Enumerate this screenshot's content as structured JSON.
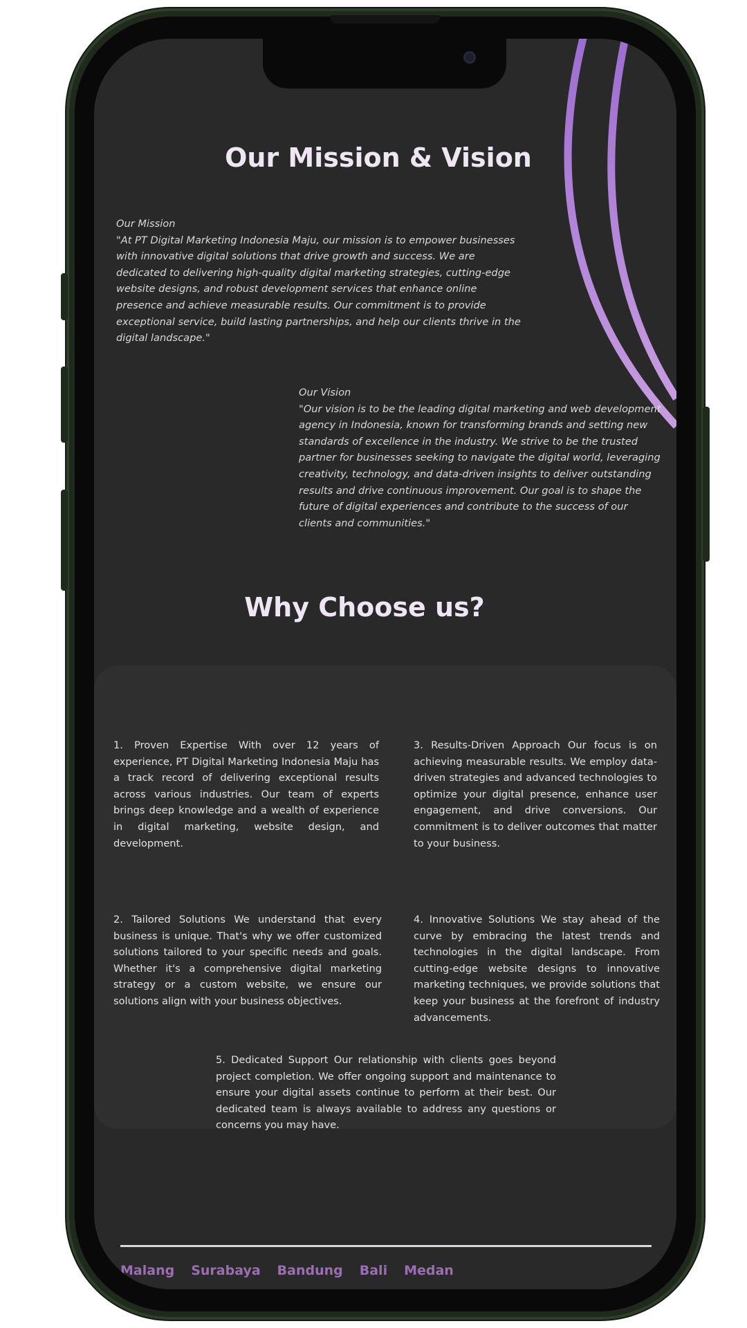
{
  "mission_vision": {
    "title": "Our Mission & Vision",
    "mission_label": "Our Mission",
    "mission_text": "\"At PT Digital Marketing Indonesia Maju, our mission is to empower businesses with innovative digital solutions that drive growth and success. We are dedicated to delivering high-quality digital marketing strategies, cutting-edge website designs, and robust development services that enhance online presence and achieve measurable results. Our commitment is to provide exceptional service, build lasting partnerships, and help our clients thrive in the digital landscape.\"",
    "vision_label": "Our Vision",
    "vision_text": "\"Our vision is to be the leading digital marketing and web development agency in Indonesia, known for transforming brands and setting new standards of excellence in the industry. We strive to be the trusted partner for businesses seeking to navigate the digital world, leveraging creativity, technology, and data-driven insights to deliver outstanding results and drive continuous improvement. Our goal is to shape the future of digital experiences and contribute to the success of our clients and communities.\""
  },
  "why_choose": {
    "title": "Why Choose us?",
    "reasons": [
      "1. Proven Expertise With over 12 years of experience, PT Digital Marketing Indonesia Maju has a track record of delivering exceptional results across various industries. Our team of experts brings deep knowledge and a wealth of experience in digital marketing, website design, and development.",
      "2. Tailored Solutions We understand that every business is unique. That's why we offer customized solutions tailored to your specific needs and goals. Whether it's a comprehensive digital marketing strategy or a custom website, we ensure our solutions align with your business objectives.",
      "3. Results-Driven Approach Our focus is on achieving measurable results. We employ data-driven strategies and advanced technologies to optimize your digital presence, enhance user engagement, and drive conversions. Our commitment is to deliver outcomes that matter to your business.",
      "4. Innovative Solutions We stay ahead of the curve by embracing the latest trends and technologies in the digital landscape. From cutting-edge website designs to innovative marketing techniques, we provide solutions that keep your business at the forefront of industry advancements.",
      "5. Dedicated Support Our relationship with clients goes beyond project completion. We offer ongoing support and maintenance to ensure your digital assets continue to perform at their best. Our dedicated team is always available to address any questions or concerns you may have."
    ]
  },
  "footer": {
    "links": [
      "Malang",
      "Surabaya",
      "Bandung",
      "Bali",
      "Medan"
    ]
  },
  "colors": {
    "screen_bg": "#292929",
    "panel_bg": "#2f2f2f",
    "accent_purple": "#9a6fb2",
    "arc_purple": "#a57dd1",
    "title_text": "#efe6f3",
    "frame_green": "#1f2a1c"
  },
  "icons": [
    "front-camera-icon",
    "decorative-arc-icon"
  ]
}
